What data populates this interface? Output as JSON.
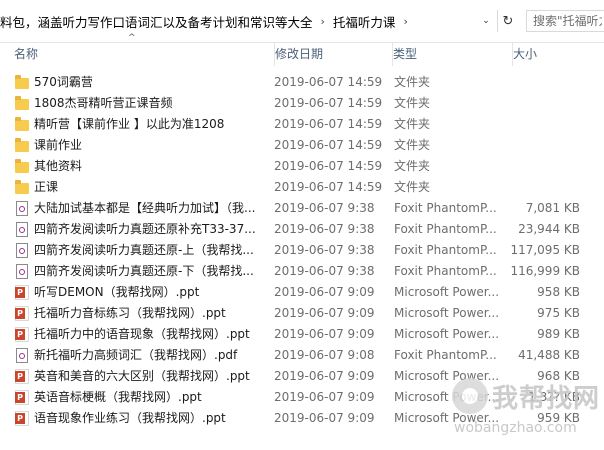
{
  "address": {
    "crumbs": [
      "料包，涵盖听力写作口语词汇以及备考计划和常识等大全",
      "托福听力课"
    ],
    "separator": "›",
    "dropdown_glyph": "⌄",
    "refresh_glyph": "↻"
  },
  "search": {
    "placeholder": "搜索\"托福听力课\""
  },
  "columns": {
    "name": "名称",
    "date": "修改日期",
    "type": "类型",
    "size": "大小"
  },
  "sort_glyph": "^",
  "files": [
    {
      "name": "570词霸营",
      "date": "2019-06-07 14:59",
      "type": "文件夹",
      "size": "",
      "icon": "folder-icon"
    },
    {
      "name": "1808杰哥精听营正课音频",
      "date": "2019-06-07 14:59",
      "type": "文件夹",
      "size": "",
      "icon": "folder-icon"
    },
    {
      "name": "精听营【课前作业 】以此为准1208",
      "date": "2019-06-07 14:59",
      "type": "文件夹",
      "size": "",
      "icon": "folder-icon"
    },
    {
      "name": "课前作业",
      "date": "2019-06-07 14:59",
      "type": "文件夹",
      "size": "",
      "icon": "folder-icon"
    },
    {
      "name": "其他资料",
      "date": "2019-06-07 14:59",
      "type": "文件夹",
      "size": "",
      "icon": "folder-icon"
    },
    {
      "name": "正课",
      "date": "2019-06-07 14:59",
      "type": "文件夹",
      "size": "",
      "icon": "folder-icon"
    },
    {
      "name": "大陆加试基本都是【经典听力加试】（我...",
      "date": "2019-06-07 9:38",
      "type": "Foxit PhantomP...",
      "size": "7,081 KB",
      "icon": "pdf-icon"
    },
    {
      "name": "四箭齐发阅读听力真题还原补充T33-37...",
      "date": "2019-06-07 9:38",
      "type": "Foxit PhantomP...",
      "size": "23,944 KB",
      "icon": "pdf-icon"
    },
    {
      "name": "四箭齐发阅读听力真题还原-上（我帮找...",
      "date": "2019-06-07 9:38",
      "type": "Foxit PhantomP...",
      "size": "117,095 KB",
      "icon": "pdf-icon"
    },
    {
      "name": "四箭齐发阅读听力真题还原-下（我帮找...",
      "date": "2019-06-07 9:38",
      "type": "Foxit PhantomP...",
      "size": "116,999 KB",
      "icon": "pdf-icon"
    },
    {
      "name": "听写DEMON（我帮找网）.ppt",
      "date": "2019-06-07 9:09",
      "type": "Microsoft Power...",
      "size": "958 KB",
      "icon": "ppt-icon"
    },
    {
      "name": "托福听力音标练习（我帮找网）.ppt",
      "date": "2019-06-07 9:09",
      "type": "Microsoft Power...",
      "size": "975 KB",
      "icon": "ppt-icon"
    },
    {
      "name": "托福听力中的语音现象（我帮找网）.ppt",
      "date": "2019-06-07 9:09",
      "type": "Microsoft Power...",
      "size": "989 KB",
      "icon": "ppt-icon"
    },
    {
      "name": "新托福听力高频词汇（我帮找网）.pdf",
      "date": "2019-06-07 9:08",
      "type": "Foxit PhantomP...",
      "size": "41,488 KB",
      "icon": "pdf-icon"
    },
    {
      "name": "英音和美音的六大区别（我帮找网）.ppt",
      "date": "2019-06-07 9:09",
      "type": "Microsoft Power...",
      "size": "968 KB",
      "icon": "ppt-icon"
    },
    {
      "name": "英语音标梗概（我帮找网）.ppt",
      "date": "2019-06-07 9:09",
      "type": "Microsoft Power...",
      "size": "1,3?? KB",
      "icon": "ppt-icon"
    },
    {
      "name": "语音现象作业练习（我帮找网）.ppt",
      "date": "2019-06-07 9:09",
      "type": "Microsoft Power...",
      "size": "959 KB",
      "icon": "ppt-icon"
    }
  ],
  "watermark": {
    "text": "我帮找网",
    "url": "wobangzhao.com"
  }
}
